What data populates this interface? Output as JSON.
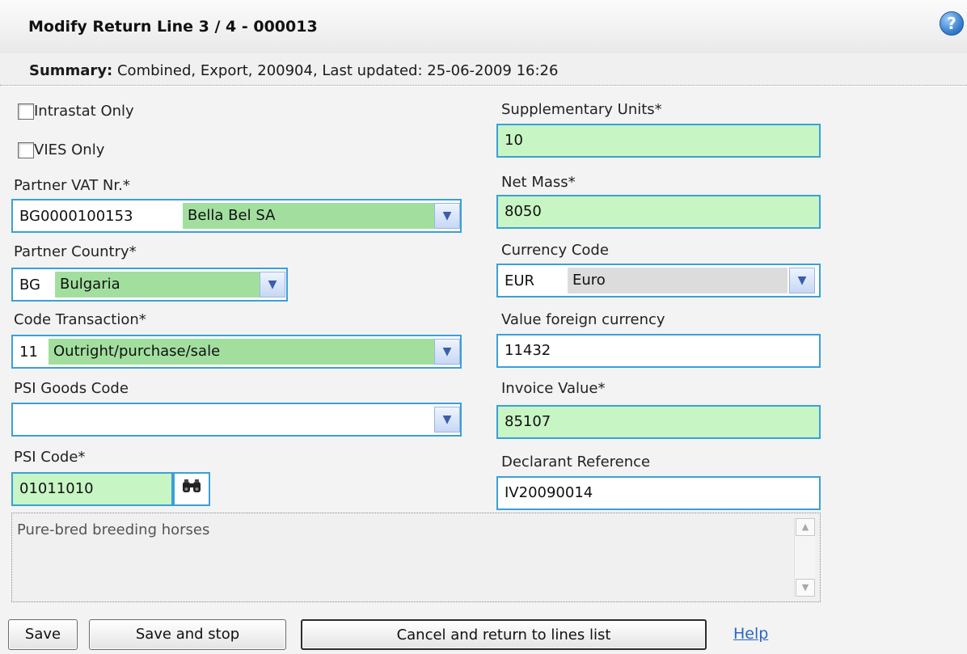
{
  "header": {
    "title": "Modify Return Line 3 / 4 - 000013",
    "help_icon": "?"
  },
  "summary": {
    "label": "Summary:",
    "text": "Combined, Export, 200904, Last updated: 25-06-2009 16:26"
  },
  "left": {
    "intrastat_only": {
      "label": "Intrastat Only",
      "checked": false
    },
    "vies_only": {
      "label": "VIES Only",
      "checked": false
    },
    "partner_vat": {
      "label": "Partner VAT Nr.*",
      "code": "BG0000100153",
      "name": "Bella Bel SA"
    },
    "partner_country": {
      "label": "Partner Country*",
      "code": "BG",
      "name": "Bulgaria"
    },
    "code_transaction": {
      "label": "Code Transaction*",
      "code": "11",
      "name": "Outright/purchase/sale"
    },
    "psi_goods_code": {
      "label": "PSI Goods Code",
      "value": ""
    },
    "psi_code": {
      "label": "PSI Code*",
      "value": "01011010",
      "lookup_icon": "binoculars-icon"
    }
  },
  "right": {
    "supplementary_units": {
      "label": "Supplementary Units*",
      "value": "10"
    },
    "net_mass": {
      "label": "Net Mass*",
      "value": "8050"
    },
    "currency_code": {
      "label": "Currency Code",
      "code": "EUR",
      "name": "Euro"
    },
    "value_foreign": {
      "label": "Value foreign currency",
      "value": "11432"
    },
    "invoice_value": {
      "label": "Invoice Value*",
      "value": "85107"
    },
    "declarant_reference": {
      "label": "Declarant Reference",
      "value": "IV20090014"
    }
  },
  "description": "Pure-bred breeding horses",
  "buttons": {
    "save": "Save",
    "save_and_stop": "Save and stop",
    "cancel": "Cancel and return to lines list",
    "help": "Help"
  },
  "colors": {
    "required_bg": "#c8f5c4",
    "border": "#3aa0d8",
    "link": "#2a66c8"
  }
}
